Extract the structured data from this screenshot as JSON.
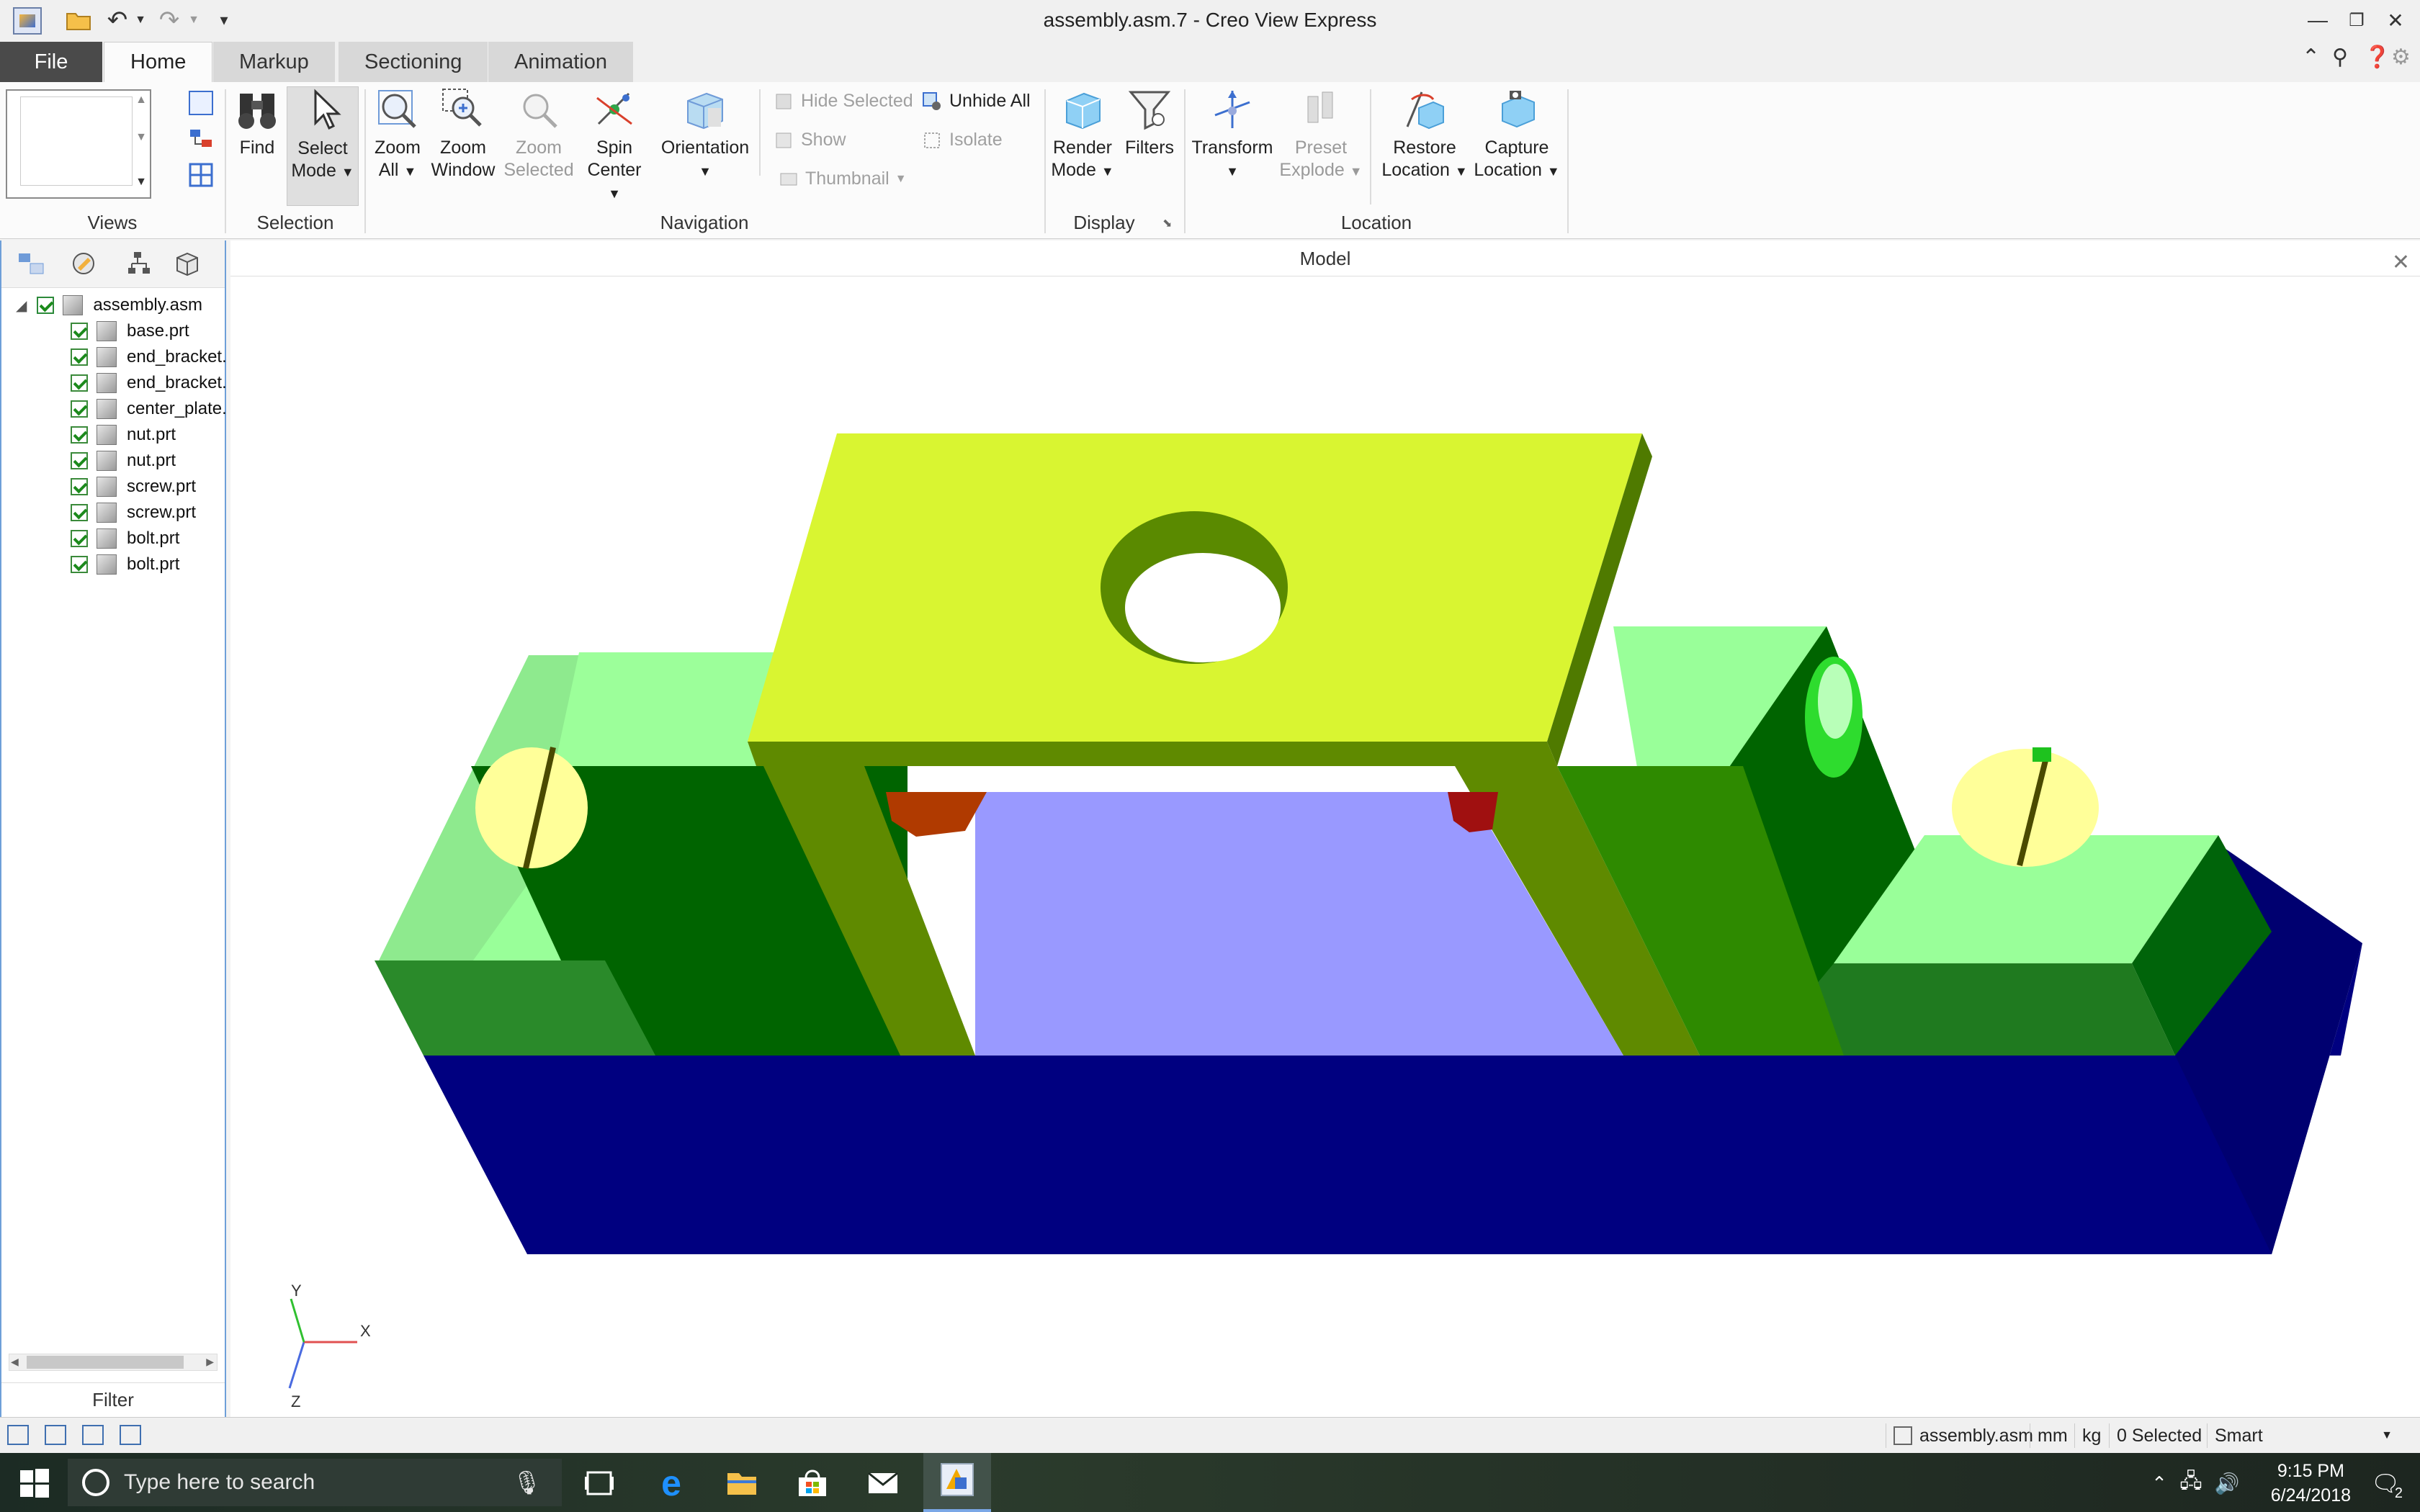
{
  "window": {
    "title": "assembly.asm.7 - Creo View Express"
  },
  "tabs": [
    {
      "label": "File"
    },
    {
      "label": "Home"
    },
    {
      "label": "Markup"
    },
    {
      "label": "Sectioning"
    },
    {
      "label": "Animation"
    }
  ],
  "ribbon": {
    "views_label": "Views",
    "selection": {
      "label": "Selection",
      "find": "Find",
      "select_mode_1": "Select",
      "select_mode_2": "Mode"
    },
    "navigation": {
      "label": "Navigation",
      "zoom_all_1": "Zoom",
      "zoom_all_2": "All",
      "zoom_window_1": "Zoom",
      "zoom_window_2": "Window",
      "zoom_selected_1": "Zoom",
      "zoom_selected_2": "Selected",
      "spin_center_1": "Spin",
      "spin_center_2": "Center",
      "orientation": "Orientation",
      "hide_selected": "Hide Selected",
      "unhide_all": "Unhide All",
      "show": "Show",
      "isolate": "Isolate",
      "thumbnail": "Thumbnail"
    },
    "display": {
      "label": "Display",
      "render_mode_1": "Render",
      "render_mode_2": "Mode",
      "filters": "Filters"
    },
    "location": {
      "label": "Location",
      "transform": "Transform",
      "preset_explode_1": "Preset",
      "preset_explode_2": "Explode",
      "restore_location_1": "Restore",
      "restore_location_2": "Location",
      "capture_location_1": "Capture",
      "capture_location_2": "Location"
    }
  },
  "tree": {
    "root": "assembly.asm",
    "items": [
      {
        "label": "base.prt"
      },
      {
        "label": "end_bracket."
      },
      {
        "label": "end_bracket."
      },
      {
        "label": "center_plate."
      },
      {
        "label": "nut.prt"
      },
      {
        "label": "nut.prt"
      },
      {
        "label": "screw.prt"
      },
      {
        "label": "screw.prt"
      },
      {
        "label": "bolt.prt"
      },
      {
        "label": "bolt.prt"
      }
    ],
    "filter_label": "Filter"
  },
  "model": {
    "header": "Model",
    "axis_x": "X",
    "axis_y": "Y",
    "axis_z": "Z",
    "colors": {
      "base": "#000080",
      "end_bracket_light": "#99ff99",
      "end_bracket_dark": "#006400",
      "center_plate_top": "#d9f531",
      "center_plate_side": "#5f8a00",
      "inner_floor": "#9999ff",
      "screw_head": "#ffff99"
    }
  },
  "status": {
    "file": "assembly.asm",
    "units_length": "mm",
    "units_mass": "kg",
    "selected": "0 Selected",
    "mode": "Smart"
  },
  "taskbar": {
    "search_placeholder": "Type here to search",
    "time": "9:15 PM",
    "date": "6/24/2018",
    "notifications": "2"
  }
}
